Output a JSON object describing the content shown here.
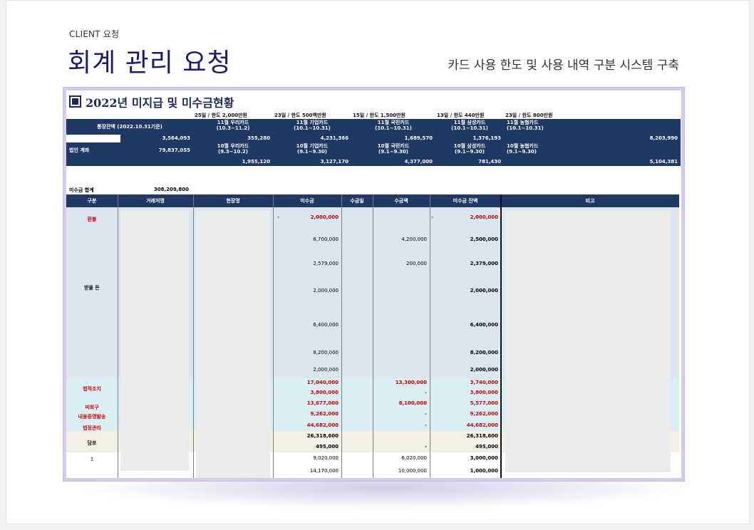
{
  "page": {
    "eyebrow": "CLIENT 요청",
    "title": "회계 관리 요청",
    "subtitle": "카드 사용 한도 및 사용 내역 구분 시스템 구축"
  },
  "sheet": {
    "title": "2022년 미지급 및 미수금현황",
    "card_headers": [
      "25일 / 한도 2,000만원",
      "23일 / 한도 500백만원",
      "15일 / 한도 1,500만원",
      "13일 / 한도 440만원",
      "23일 / 한도 800만원"
    ],
    "balance_label": "통장잔액 (2022.10.31기준)",
    "corp_label": "법인 계좌",
    "balance_values": [
      "3,564,093",
      "79,837,055"
    ],
    "cards_nov": [
      "11월 우리카드\n(10.3~11.2)",
      "11월 기업카드\n(10.1~10.31)",
      "11월 국민카드\n(10.1~10.31)",
      "11월 삼성카드\n(10.1~10.31)",
      "11월 농협카드\n(10.1~10.31)"
    ],
    "nov_values": [
      "355,280",
      "4,231,366",
      "1,689,570",
      "1,376,193",
      "8,203,990"
    ],
    "cards_oct": [
      "10월 우리카드\n(9.3~10.2)",
      "10월 기업카드\n(9.1~9.30)",
      "10월 국민카드\n(9.1~9.30)",
      "10월 삼성카드\n(9.1~9.30)",
      "10월 농협카드\n(9.1~9.30)"
    ],
    "oct_values": [
      "1,955,120",
      "3,127,170",
      "4,377,000",
      "781,430",
      "5,104,381"
    ],
    "receivable_total_label": "미수금 합계",
    "receivable_total": "308,209,800",
    "columns": [
      "구분",
      "거래처명",
      "현장명",
      "미수금",
      "수금일",
      "수금액",
      "미수금 잔액",
      "비고"
    ],
    "categories": {
      "refund": "환불",
      "receivable": "받을 돈",
      "legal": "법적조치",
      "uncollected": "미회구",
      "certified": "내용증명발송",
      "legal_mgmt": "법정관리",
      "collateral": "담포",
      "one": "1"
    },
    "rows": [
      {
        "amt": "2,000,000",
        "got": "",
        "bal": "2,000,000",
        "red": true,
        "minus": true
      },
      {
        "amt": "6,700,000",
        "got": "4,200,000",
        "bal": "2,500,000",
        "red": false
      },
      {
        "amt": "2,579,000",
        "got": "200,000",
        "bal": "2,379,000",
        "red": false
      },
      {
        "amt": "2,000,000",
        "got": "",
        "bal": "2,000,000",
        "red": false
      },
      {
        "amt": "6,400,000",
        "got": "",
        "bal": "6,400,000",
        "red": false
      },
      {
        "amt": "8,200,000",
        "got": "",
        "bal": "8,200,000",
        "red": false
      },
      {
        "amt": "2,000,000",
        "got": "",
        "bal": "2,000,000",
        "red": false
      },
      {
        "amt": "17,040,000",
        "got": "13,300,000",
        "bal": "3,740,000",
        "red": true
      },
      {
        "amt": "3,800,000",
        "got": "-",
        "bal": "3,800,000",
        "red": true
      },
      {
        "amt": "13,677,000",
        "got": "8,100,000",
        "bal": "5,577,000",
        "red": true
      },
      {
        "amt": "9,262,000",
        "got": "-",
        "bal": "9,262,000",
        "red": true
      },
      {
        "amt": "44,682,000",
        "got": "-",
        "bal": "44,682,000",
        "red": true
      },
      {
        "amt": "26,318,600",
        "got": "",
        "bal": "26,318,600",
        "red": false,
        "bold": true
      },
      {
        "amt": "495,000",
        "got": "-",
        "bal": "495,000",
        "red": false,
        "bold": true
      },
      {
        "amt": "9,020,000",
        "got": "6,020,000",
        "bal": "3,000,000",
        "red": false
      },
      {
        "amt": "14,170,000",
        "got": "10,000,000",
        "bal": "1,000,000",
        "red": false
      }
    ]
  },
  "colors": {
    "title": "#1d1b6b",
    "navy": "#1f3864",
    "red": "#d00000",
    "frame": "#d6cce8"
  }
}
